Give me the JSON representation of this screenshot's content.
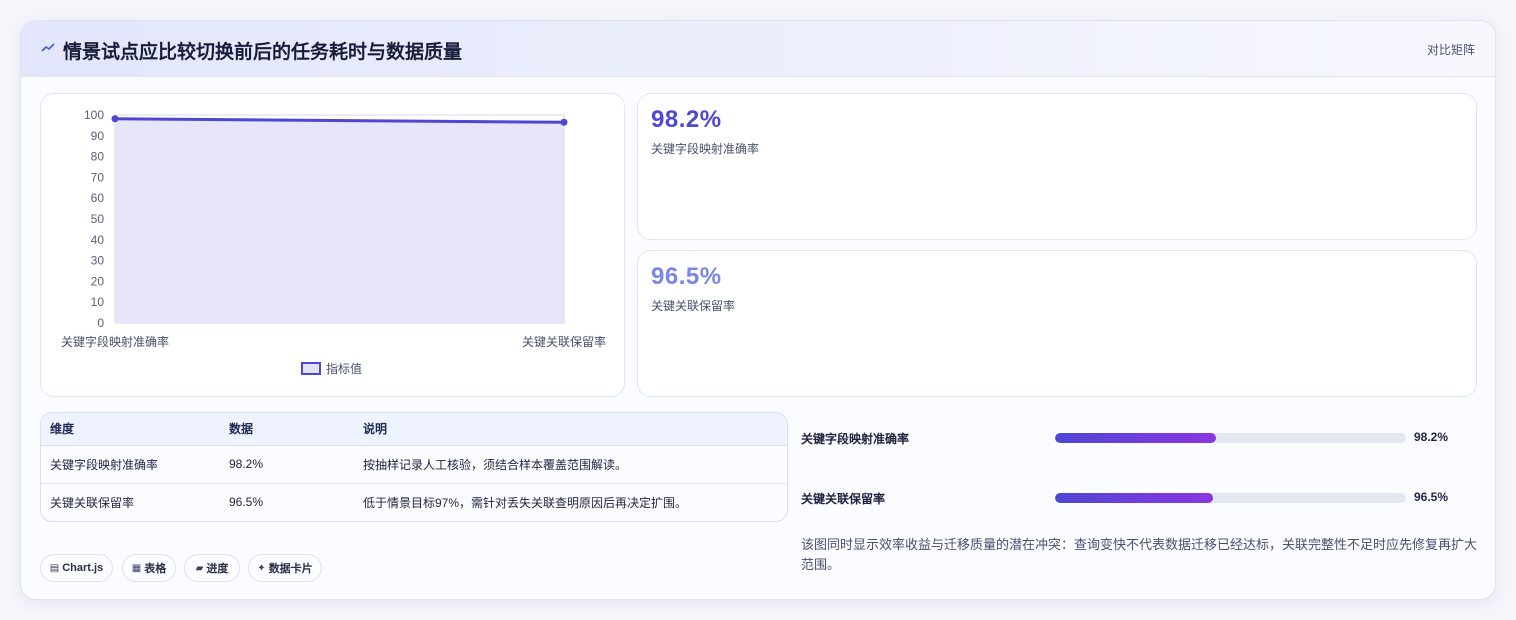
{
  "header": {
    "title": "情景试点应比较切换前后的任务耗时与数据质量",
    "tag": "对比矩阵"
  },
  "colors": {
    "line": "#4f46d4",
    "area": "#e4e2f8",
    "stat1": "#4f46d4",
    "stat2": "#7b87e6"
  },
  "chart_data": {
    "type": "line",
    "categories": [
      "关键字段映射准确率",
      "关键关联保留率"
    ],
    "series": [
      {
        "name": "指标值",
        "values": [
          98.2,
          96.5
        ]
      }
    ],
    "ylim": [
      0,
      100
    ],
    "yticks": [
      0,
      10,
      20,
      30,
      40,
      50,
      60,
      70,
      80,
      90,
      100
    ],
    "grid": true,
    "legend_position": "bottom"
  },
  "stats": [
    {
      "value": "98.2%",
      "label": "关键字段映射准确率"
    },
    {
      "value": "96.5%",
      "label": "关键关联保留率"
    }
  ],
  "table": {
    "headers": [
      "维度",
      "数据",
      "说明"
    ],
    "rows": [
      [
        "关键字段映射准确率",
        "98.2%",
        "按抽样记录人工核验，须结合样本覆盖范围解读。"
      ],
      [
        "关键关联保留率",
        "96.5%",
        "低于情景目标97%，需针对丢失关联查明原因后再决定扩围。"
      ]
    ]
  },
  "progress": [
    {
      "label": "关键字段映射准确率",
      "value": "98.2%",
      "fraction": 0.46
    },
    {
      "label": "关键关联保留率",
      "value": "96.5%",
      "fraction": 0.45
    }
  ],
  "note": "该图同时显示效率收益与迁移质量的潜在冲突：查询变快不代表数据迁移已经达标，关联完整性不足时应先修复再扩大范围。",
  "pills": [
    {
      "icon": "▤",
      "icon_name": "chart-icon",
      "label": "Chart.js"
    },
    {
      "icon": "▦",
      "icon_name": "table-icon",
      "label": "表格"
    },
    {
      "icon": "▰",
      "icon_name": "progress-icon",
      "label": "进度"
    },
    {
      "icon": "✦",
      "icon_name": "sparkle-icon",
      "label": "数据卡片"
    }
  ]
}
